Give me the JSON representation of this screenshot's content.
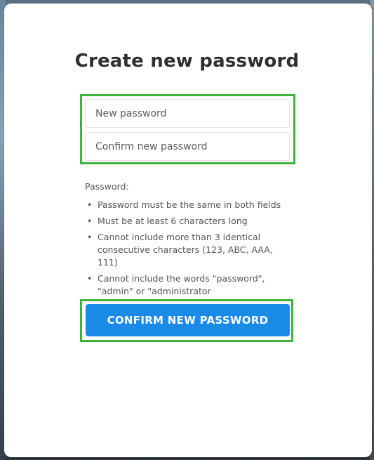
{
  "form": {
    "title": "Create new password",
    "new_password": {
      "value": "",
      "placeholder": "New password"
    },
    "confirm_password": {
      "value": "",
      "placeholder": "Confirm new password"
    },
    "requirements_heading": "Password:",
    "requirements": [
      "Password must be the same in both fields",
      "Must be at least 6 characters long",
      "Cannot include more than 3 identical consecutive characters (123, ABC, AAA, 111)",
      "Cannot include the words \"password\", \"admin\" or \"administrator"
    ],
    "submit_label": "CONFIRM NEW PASSWORD"
  },
  "colors": {
    "primary_button": "#1a8be8",
    "highlight_border": "#3db33d",
    "title_text": "#2f2f2f",
    "body_text": "#555555"
  }
}
